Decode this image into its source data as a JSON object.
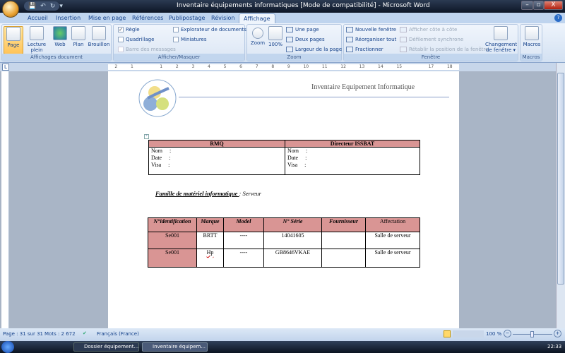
{
  "window": {
    "title": "Inventaire équipements informatiques [Mode de compatibilité] - Microsoft Word",
    "minimize": "–",
    "maximize": "▫",
    "close": "X"
  },
  "qat": {
    "save": "💾",
    "undo": "↶",
    "redo": "↻",
    "customize": "▾"
  },
  "tabs": [
    "Accueil",
    "Insertion",
    "Mise en page",
    "Références",
    "Publipostage",
    "Révision",
    "Affichage"
  ],
  "active_tab": "Affichage",
  "ribbon": {
    "views": {
      "label": "Affichages document",
      "buttons": [
        "Page",
        "Lecture plein écran",
        "Web",
        "Plan",
        "Brouillon"
      ]
    },
    "show": {
      "label": "Afficher/Masquer",
      "items": [
        {
          "label": "Règle",
          "checked": true
        },
        {
          "label": "Quadrillage",
          "checked": false
        },
        {
          "label": "Barre des messages",
          "checked": false,
          "disabled": true
        },
        {
          "label": "Explorateur de documents",
          "checked": false
        },
        {
          "label": "Miniatures",
          "checked": false
        }
      ]
    },
    "zoom": {
      "label": "Zoom",
      "zoom": "Zoom",
      "hundred": "100%",
      "one_page": "Une page",
      "two_pages": "Deux pages",
      "page_width": "Largeur de la page"
    },
    "window": {
      "label": "Fenêtre",
      "new_window": "Nouvelle fenêtre",
      "arrange_all": "Réorganiser tout",
      "split": "Fractionner",
      "side_by_side": "Afficher côte à côte",
      "sync_scroll": "Défilement synchrone",
      "reset_pos": "Rétablir la position de la fenêtre",
      "switch": "Changement de fenêtre ▾"
    },
    "macros": {
      "label": "Macros",
      "button": "Macros"
    }
  },
  "ruler": {
    "toggle": "L",
    "ticks": [
      "2",
      "1",
      "",
      "1",
      "2",
      "3",
      "4",
      "5",
      "6",
      "7",
      "8",
      "9",
      "10",
      "11",
      "12",
      "13",
      "14",
      "15",
      "",
      "17",
      "18"
    ]
  },
  "document": {
    "header_title": "Inventaire Equipement Informatique",
    "sign_table": {
      "headers": [
        "RMQ",
        "Directeur ISSBAT"
      ],
      "lines": [
        "Nom     :",
        "Date     :",
        "Visa     :"
      ]
    },
    "family_label": "Famille de matériel informatique ",
    "family_value": ": Serveur",
    "inventory": {
      "headers": [
        "N°identification",
        "Marque",
        "Model",
        "N° Série",
        "Fournisseur",
        "Affectation"
      ],
      "rows": [
        [
          "Se001",
          "BRTT",
          "----",
          "14041605",
          "",
          "Salle de serveur"
        ],
        [
          "Se001",
          "Hp",
          "----",
          "GB8646VKAE",
          "",
          "Salle de serveur"
        ]
      ]
    }
  },
  "status": {
    "page": "Page : 31 sur 31",
    "words": "Mots : 2 672",
    "language": "Français (France)",
    "zoom": "100 %"
  },
  "taskbar": {
    "items": [
      "Dossier équipement...",
      "Inventaire équipem..."
    ],
    "time": "22:33"
  }
}
